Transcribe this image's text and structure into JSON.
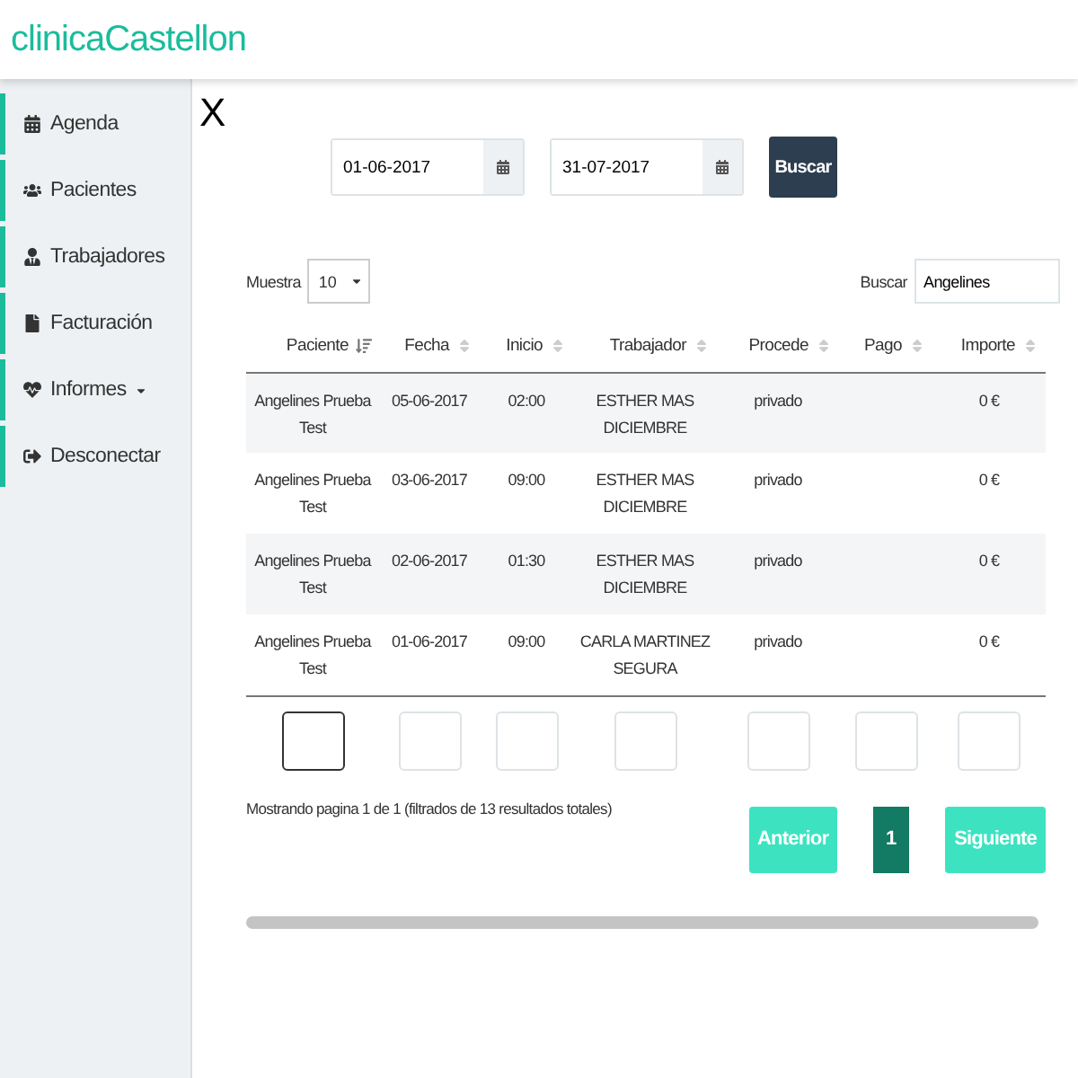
{
  "header": {
    "title": "clinicaCastellon"
  },
  "sidebar": {
    "items": [
      {
        "label": "Agenda",
        "dropdown": false
      },
      {
        "label": "Pacientes",
        "dropdown": false
      },
      {
        "label": "Trabajadores",
        "dropdown": false
      },
      {
        "label": "Facturación",
        "dropdown": false
      },
      {
        "label": "Informes",
        "dropdown": true
      },
      {
        "label": "Desconectar",
        "dropdown": false
      }
    ]
  },
  "close": {
    "label": "X"
  },
  "date_filter": {
    "from": "01-06-2017",
    "to": "31-07-2017",
    "button": "Buscar"
  },
  "table_controls": {
    "length_label": "Muestra",
    "length_value": "10",
    "search_label": "Buscar",
    "search_value": "Angelines"
  },
  "table": {
    "columns": [
      {
        "label": "Paciente",
        "sorted": true
      },
      {
        "label": "Fecha",
        "sorted": false
      },
      {
        "label": "Inicio",
        "sorted": false
      },
      {
        "label": "Trabajador",
        "sorted": false
      },
      {
        "label": "Procede",
        "sorted": false
      },
      {
        "label": "Pago",
        "sorted": false
      },
      {
        "label": "Importe",
        "sorted": false
      }
    ],
    "rows": [
      [
        "Angelines Prueba Test",
        "05-06-2017",
        "02:00",
        "ESTHER MAS DICIEMBRE",
        "privado",
        "",
        "0 €"
      ],
      [
        "Angelines Prueba Test",
        "03-06-2017",
        "09:00",
        "ESTHER MAS DICIEMBRE",
        "privado",
        "",
        "0 €"
      ],
      [
        "Angelines Prueba Test",
        "02-06-2017",
        "01:30",
        "ESTHER MAS DICIEMBRE",
        "privado",
        "",
        "0 €"
      ],
      [
        "Angelines Prueba Test",
        "01-06-2017",
        "09:00",
        "CARLA MARTINEZ SEGURA",
        "privado",
        "",
        "0 €"
      ]
    ],
    "filters": [
      {
        "focused": true
      },
      {
        "focused": false
      },
      {
        "focused": false
      },
      {
        "focused": false
      },
      {
        "focused": false
      },
      {
        "focused": false
      },
      {
        "focused": false
      }
    ]
  },
  "info": "Mostrando pagina 1 de 1 (filtrados de 13 resultados totales)",
  "pagination": {
    "previous": "Anterior",
    "pages": [
      {
        "label": "1",
        "selected": true
      }
    ],
    "next": "Siguiente"
  }
}
